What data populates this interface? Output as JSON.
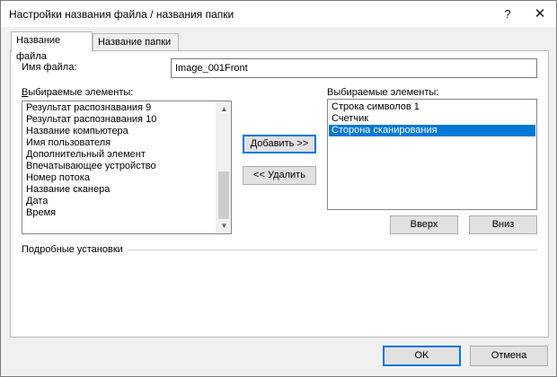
{
  "window": {
    "title": "Настройки названия файла / названия папки",
    "help_glyph": "?",
    "close_glyph": "✕"
  },
  "tabs": [
    {
      "label": "Название файла",
      "active": true
    },
    {
      "label": "Название папки",
      "active": false
    }
  ],
  "file_name": {
    "label": "Имя файла:",
    "value": "Image_001Front"
  },
  "available": {
    "label_prefix": "В",
    "label_rest": "ыбираемые элементы:",
    "items": [
      "Результат распознавания 9",
      "Результат распознавания 10",
      "Название компьютера",
      "Имя пользователя",
      "Дополнительный элемент",
      "Впечатывающее устройство",
      "Номер потока",
      "Название сканера",
      "Дата",
      "Время"
    ]
  },
  "selected": {
    "label": "Выбираемые элементы:",
    "items": [
      {
        "text": "Строка символов 1",
        "selected": false
      },
      {
        "text": "Счетчик",
        "selected": false
      },
      {
        "text": "Сторона сканирования",
        "selected": true
      }
    ]
  },
  "buttons": {
    "add": "Добавить >>",
    "remove": "<< Удалить",
    "up": "Вверх",
    "down": "Вниз",
    "ok": "OK",
    "cancel": "Отмена"
  },
  "advanced": {
    "label": "Подробные установки"
  },
  "colors": {
    "selection": "#0078d7",
    "dialog_bg": "#f0f0f0"
  }
}
